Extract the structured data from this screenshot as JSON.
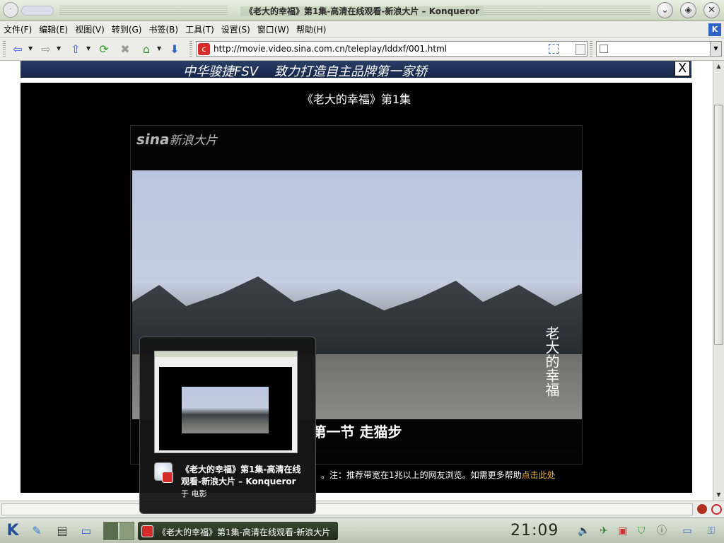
{
  "window": {
    "title": "《老大的幸福》第1集-高清在线观看-新浪大片 – Konqueror"
  },
  "menu": [
    "文件(F)",
    "编辑(E)",
    "视图(V)",
    "转到(G)",
    "书签(B)",
    "工具(T)",
    "设置(S)",
    "窗口(W)",
    "帮助(H)"
  ],
  "address": {
    "url": "http://movie.video.sina.com.cn/teleplay/lddxf/001.html"
  },
  "search": {
    "value": ""
  },
  "page": {
    "banner_text": "中华骏捷FSV    致力打造自主品牌第一家轿",
    "banner_close": "X",
    "episode_title": "《老大的幸福》第1集",
    "player_logo_brand": "sina",
    "player_logo_text": "新浪大片",
    "video_calligraphy": "老大的幸福",
    "video_subtitle": "第一节  走猫步",
    "note_text": "。注：推荐带宽在1兆以上的网友浏览。如需更多帮助",
    "note_link": "点击此处"
  },
  "tooltip": {
    "title": "《老大的幸福》第1集-高清在线观看-新浪大片 – Konqueror",
    "subtitle": "于 电影"
  },
  "taskbar": {
    "task_label": "《老大的幸福》第1集-高清在线观看-新浪大片",
    "clock": "21:09"
  },
  "colors": {
    "titlebar": "#c9d6bf",
    "link_accent": "#f5b43a",
    "favicon_red": "#d62b2b"
  }
}
